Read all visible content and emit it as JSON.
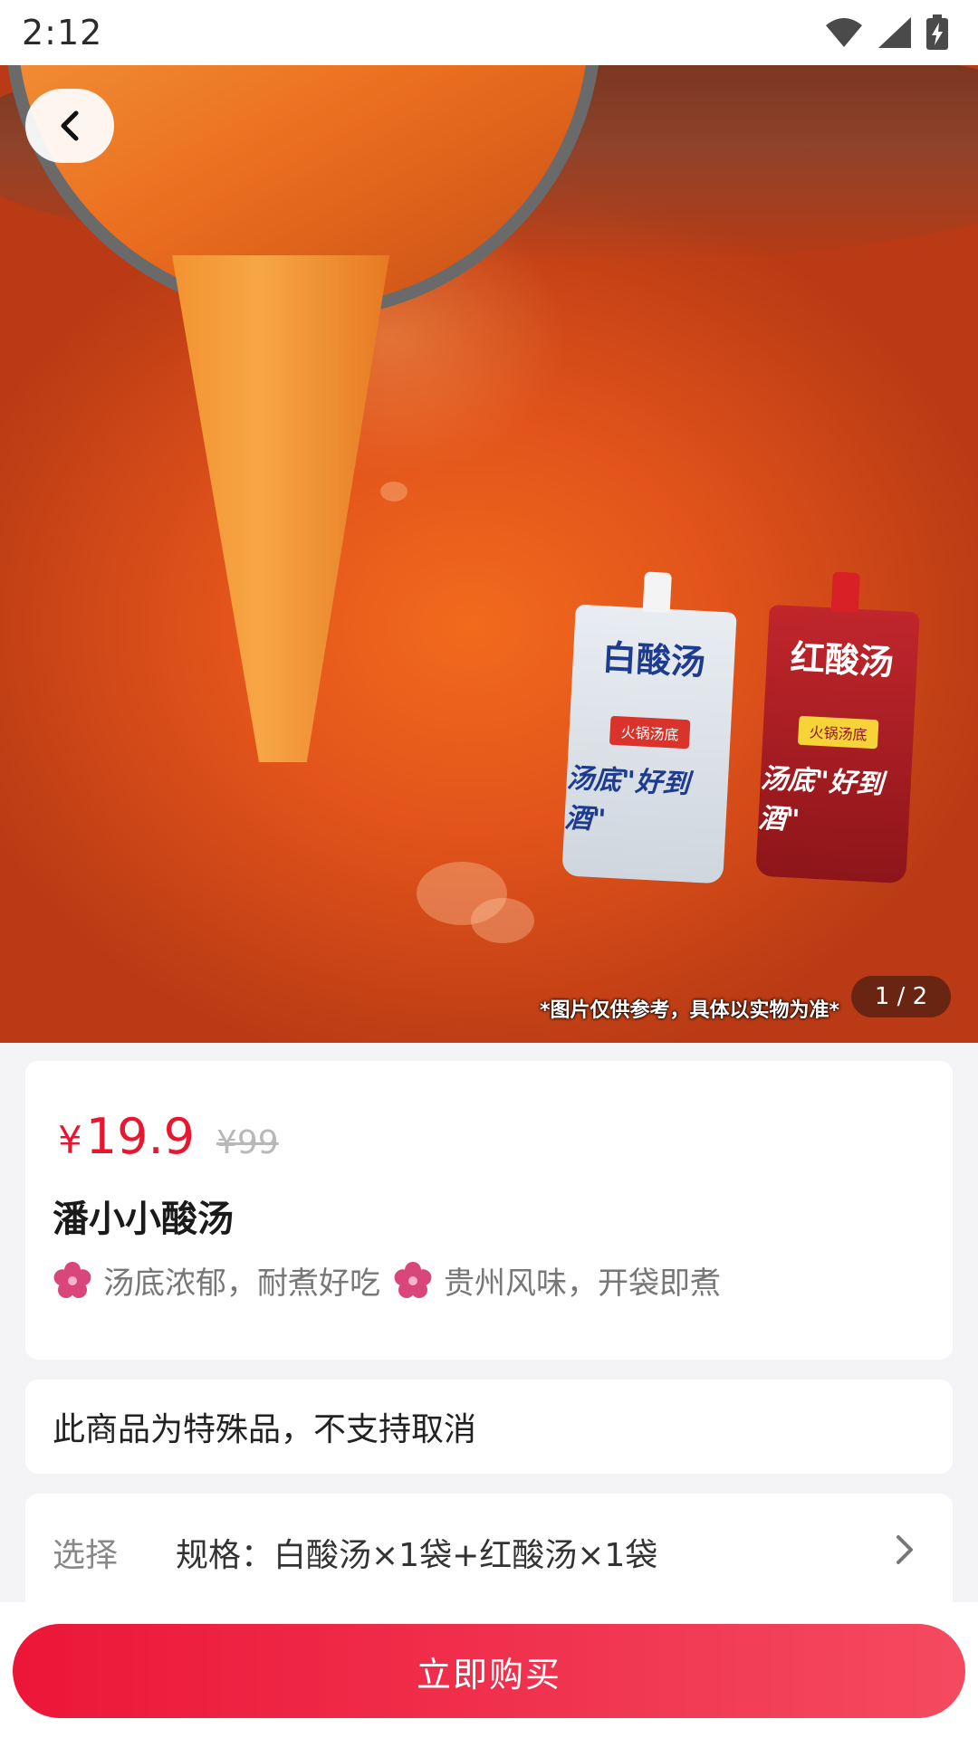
{
  "status_bar": {
    "time": "2:12"
  },
  "hero": {
    "pouch_white_name": "白酸汤",
    "pouch_red_name": "红酸汤",
    "pouch_badge": "火锅汤底",
    "pouch_slogan": "汤底\"好到酒\"",
    "disclaimer": "*图片仅供参考，具体以实物为准*",
    "counter": "1 / 2"
  },
  "product": {
    "price_current": "19.9",
    "currency": "¥",
    "price_original": "¥99",
    "title": "潘小小酸汤",
    "features": [
      {
        "icon": "flower-icon",
        "text": "汤底浓郁，耐煮好吃"
      },
      {
        "icon": "flower-icon",
        "text": "贵州风味，开袋即煮"
      }
    ]
  },
  "notice": {
    "text": "此商品为特殊品，不支持取消"
  },
  "spec": {
    "label": "选择",
    "value": "规格：白酸汤×1袋+红酸汤×1袋"
  },
  "bottom": {
    "buy_label": "立即购买"
  },
  "colors": {
    "accent": "#e8162e",
    "button_start": "#ec1638",
    "button_end": "#f44a60",
    "feature_icon": "#d9467a"
  }
}
